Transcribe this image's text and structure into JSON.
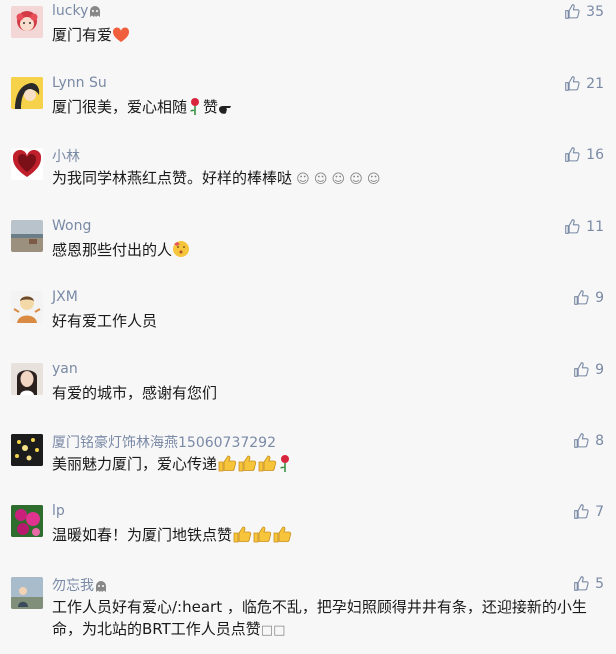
{
  "comments": [
    {
      "nick": "lucky",
      "text": "厦门有爱",
      "likes": "35"
    },
    {
      "nick": "Lynn Su",
      "text": "厦门很美，爱心相随",
      "suffix": "赞",
      "likes": "21"
    },
    {
      "nick": "小林",
      "text": "为我同学林燕红点赞。好样的棒棒哒",
      "likes": "16"
    },
    {
      "nick": "Wong",
      "text": "感恩那些付出的人",
      "likes": "11"
    },
    {
      "nick": "JXM",
      "text": "好有爱工作人员",
      "likes": "9"
    },
    {
      "nick": "yan",
      "text": "有爱的城市，感谢有您们",
      "likes": "9"
    },
    {
      "nick": "厦门铭豪灯饰林海燕15060737292",
      "text": "美丽魅力厦门，爱心传递",
      "likes": "8"
    },
    {
      "nick": "lp",
      "text": "温暖如春！为厦门地铁点赞",
      "likes": "7"
    },
    {
      "nick": "勿忘我",
      "text": "工作人员好有爱心/:heart ，临危不乱，把孕妇照顾得井井有条，还迎接新的小生命，为北站的BRT工作人员点赞",
      "likes": "5"
    }
  ]
}
